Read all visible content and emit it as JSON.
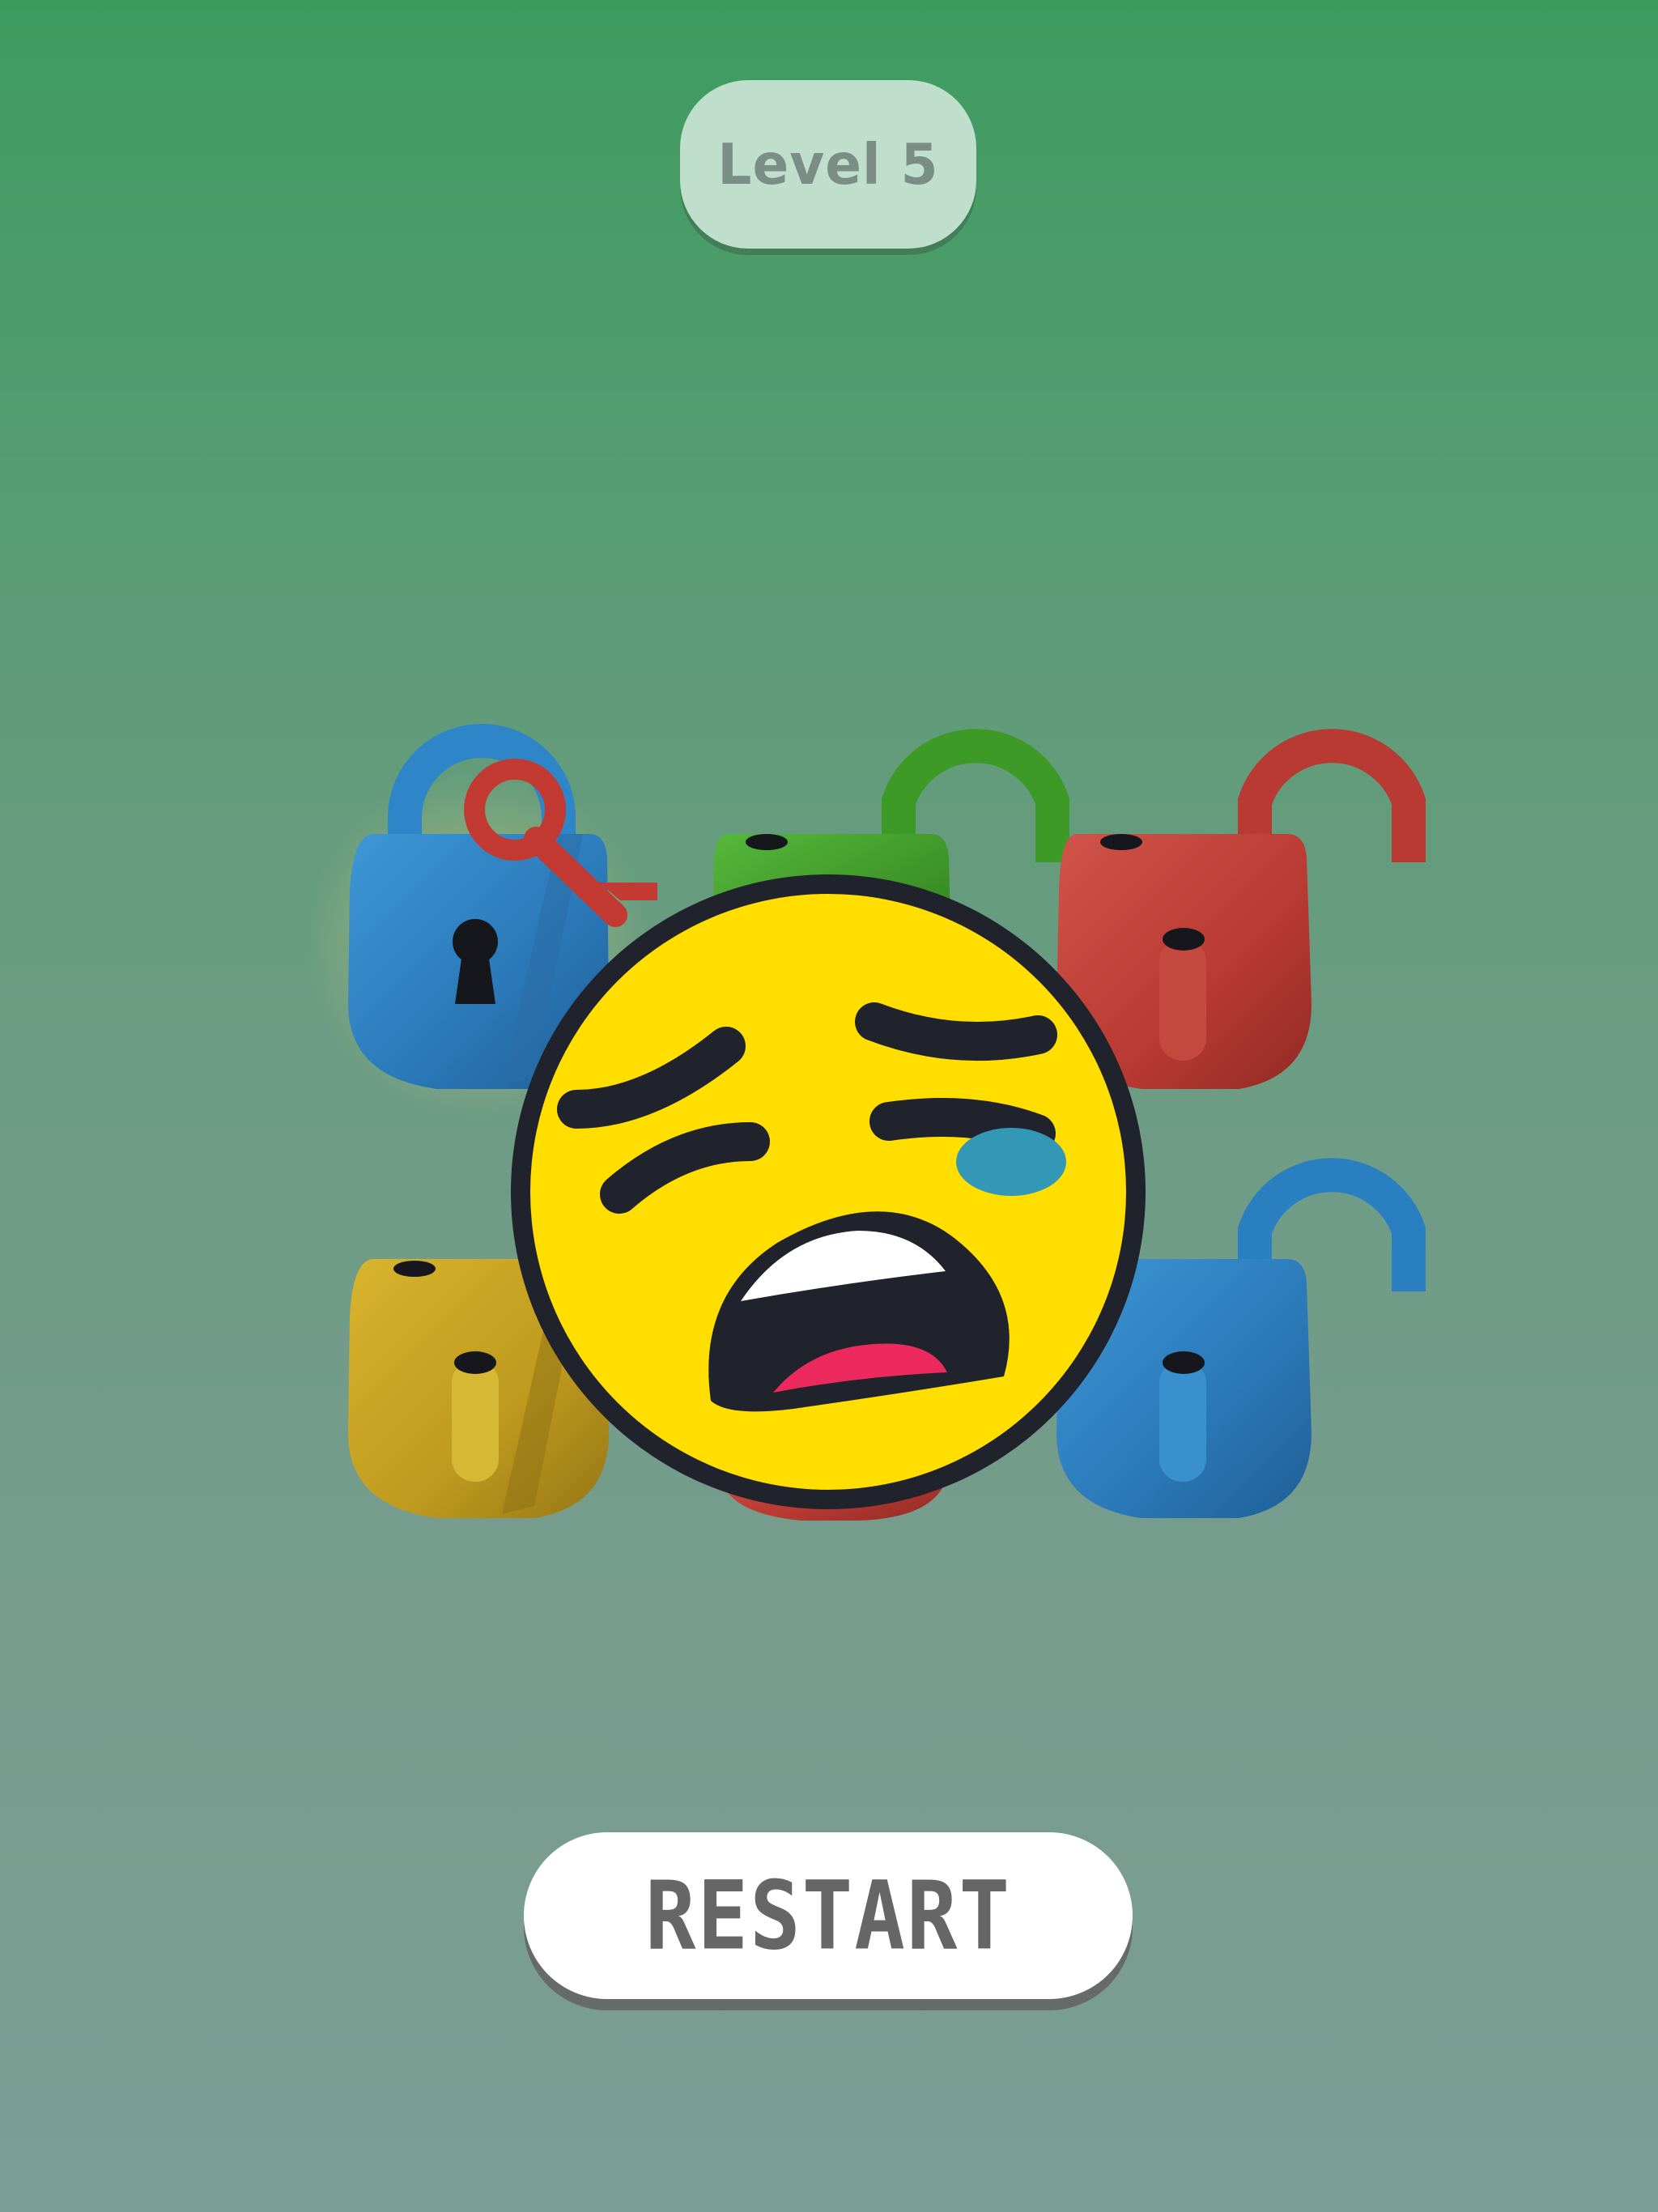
{
  "hud": {
    "level_label": "Level 5"
  },
  "result": {
    "emoji": "crying-face-icon"
  },
  "locks": [
    {
      "id": "blue-lock-top-left",
      "color": "#2a78b8",
      "state": "locked"
    },
    {
      "id": "green-lock-top-center",
      "color": "#3e9a26",
      "state": "open"
    },
    {
      "id": "red-lock-top-right",
      "color": "#b83a32",
      "state": "open"
    },
    {
      "id": "yellow-lock-bottom-left",
      "color": "#c8a422",
      "state": "open"
    },
    {
      "id": "red-lock-bottom-center",
      "color": "#b83a32",
      "state": "open"
    },
    {
      "id": "blue-lock-bottom-right",
      "color": "#2a7fc0",
      "state": "open"
    }
  ],
  "key": {
    "color": "#c23a32"
  },
  "actions": {
    "restart_label": "RESTART"
  }
}
